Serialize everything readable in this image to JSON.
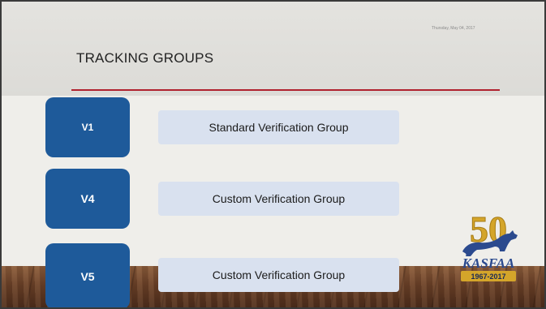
{
  "slide": {
    "date": "Thursday, May 04, 2017",
    "title": "TRACKING GROUPS"
  },
  "groups": [
    {
      "code": "V1",
      "label": "Standard Verification Group"
    },
    {
      "code": "V4",
      "label": "Custom Verification Group"
    },
    {
      "code": "V5",
      "label": "Custom Verification Group"
    }
  ],
  "logo": {
    "number": "50",
    "name": "KASFAA",
    "years": "1967-2017"
  },
  "colors": {
    "box_blue": "#1e5a9a",
    "group_box": "#d9e1ef",
    "title_rule": "#b0222f",
    "logo_gold": "#d4a52a",
    "logo_blue": "#2b4a8e"
  },
  "icons": {
    "logo_horse": "horse-silhouette-icon"
  }
}
